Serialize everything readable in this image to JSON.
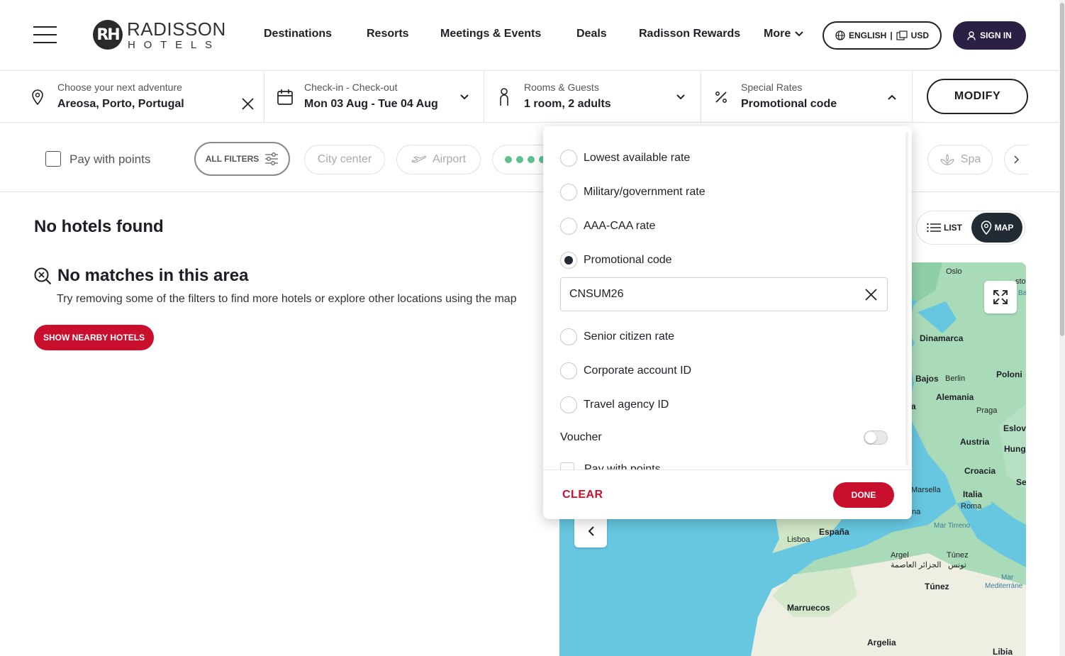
{
  "brand": {
    "mark": "RH",
    "name": "RADISSON",
    "sub": "HOTELS"
  },
  "nav": {
    "destinations": "Destinations",
    "resorts": "Resorts",
    "meetings": "Meetings & Events",
    "deals": "Deals",
    "rewards": "Radisson Rewards",
    "more": "More"
  },
  "locale": {
    "language": "ENGLISH",
    "separator": "|",
    "currency": "USD"
  },
  "signin": "SIGN IN",
  "search": {
    "destination_label": "Choose your next adventure",
    "destination_value": "Areosa, Porto, Portugal",
    "dates_label": "Check-in - Check-out",
    "dates_value": "Mon 03 Aug - Tue 04 Aug",
    "guests_label": "Rooms & Guests",
    "guests_value": "1 room, 2 adults",
    "rates_label": "Special Rates",
    "rates_value": "Promotional code",
    "modify": "MODIFY"
  },
  "filters": {
    "pay_with_points": "Pay with points",
    "all_filters": "ALL FILTERS",
    "city_center": "City center",
    "airport": "Airport",
    "spa": "Spa"
  },
  "results": {
    "title": "No hotels found",
    "no_matches": "No matches in this area",
    "hint": "Try removing some of the filters to find more hotels or explore other locations using the map",
    "nearby_button": "SHOW NEARBY HOTELS",
    "list": "LIST",
    "map": "MAP"
  },
  "special_rates": {
    "options": {
      "lowest": "Lowest available rate",
      "military": "Military/government rate",
      "aaa": "AAA-CAA rate",
      "promo": "Promotional code",
      "senior": "Senior citizen rate",
      "corporate": "Corporate account ID",
      "travel": "Travel agency ID"
    },
    "selected": "Promotional code",
    "promo_code_value": "CNSUM26",
    "voucher_label": "Voucher",
    "voucher_on": false,
    "pay_points_partial": "Pay with points",
    "clear": "CLEAR",
    "done": "DONE"
  },
  "map_labels": {
    "oslo": "Oslo",
    "dinamarca": "Dinamarca",
    "polonia": "Poloni",
    "bajos": "Bajos",
    "berlin": "Berlin",
    "alemania": "Alemania",
    "praga": "Praga",
    "eslov": "Eslov",
    "austria": "Austria",
    "hung": "Hung",
    "croacia": "Croacia",
    "se": "Se",
    "marsella": "Marsella",
    "italia": "Italia",
    "roma": "Roma",
    "na": "na",
    "a": "a",
    "mar_tirreno": "Mar Tirreno",
    "espana": "España",
    "lisboa": "Lisboa",
    "argel": "Argel",
    "argel_ar": "الجزائر العاصمة",
    "tunez": "Túnez",
    "tunez_ar": "تونس",
    "tunez_country": "Túnez",
    "mar_med1": "Mar",
    "mar_med2": "Mediterráne",
    "marruecos": "Marruecos",
    "argelia": "Argelia",
    "libia": "Libia",
    "sto": "sto",
    "ba": "Ba"
  },
  "colors": {
    "brand_red": "#c8102e",
    "brand_dark": "#2b1f44",
    "map_water": "#67c7e0",
    "map_land": "#9fd8b8"
  }
}
